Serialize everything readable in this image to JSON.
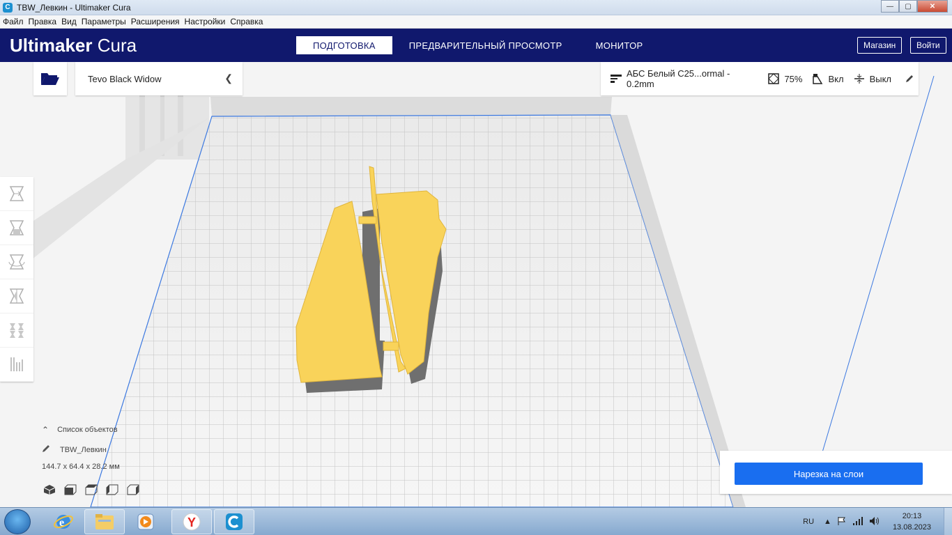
{
  "window": {
    "title": "TBW_Левкин - Ultimaker Cura",
    "controls": [
      "—",
      "▢",
      "✕"
    ]
  },
  "menu": [
    "Файл",
    "Правка",
    "Вид",
    "Параметры",
    "Расширения",
    "Настройки",
    "Справка"
  ],
  "header": {
    "logo_brand": "Ultimaker",
    "logo_product": " Cura",
    "stages": [
      "ПОДГОТОВКА",
      "ПРЕДВАРИТЕЛЬНЫЙ ПРОСМОТР",
      "МОНИТОР"
    ],
    "active_stage": "ПОДГОТОВКА",
    "marketplace": "Магазин",
    "signin": "Войти"
  },
  "printer": {
    "name": "Tevo Black Widow"
  },
  "settings": {
    "profile": "АБС Белый С25...ormal - 0.2mm",
    "infill": "75%",
    "support": "Вкл",
    "adhesion": "Выкл"
  },
  "tools": [
    "move-icon",
    "scale-icon",
    "rotate-icon",
    "mirror-icon",
    "per-model-settings-icon",
    "support-blocker-icon"
  ],
  "objects": {
    "header": "Список объектов",
    "item": "TBW_Левкин",
    "dimensions": "144.7 x 64.4 x 28.2 мм"
  },
  "slice": {
    "label": "Нарезка на слои"
  },
  "taskbar": {
    "lang": "RU",
    "time": "20:13",
    "date": "13.08.2023"
  },
  "colors": {
    "header_bg": "#10186d",
    "model_yellow": "#f9d35a",
    "slice_blue": "#196ef0"
  }
}
